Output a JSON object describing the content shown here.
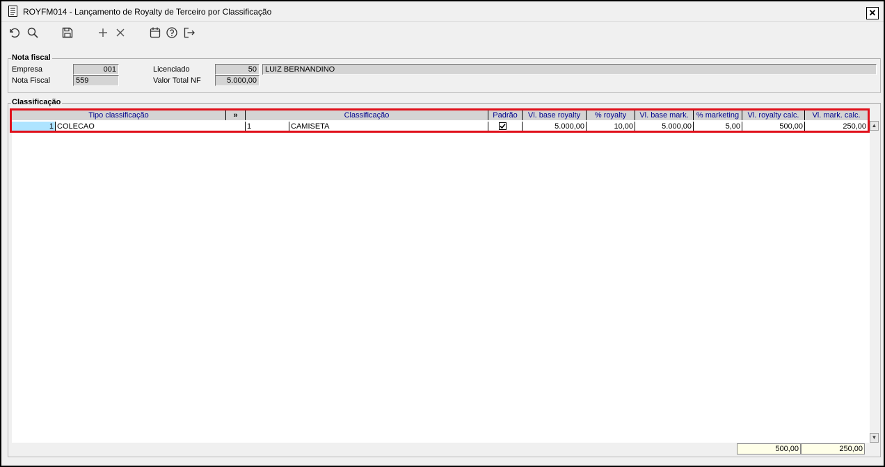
{
  "window": {
    "title": "ROYFM014 - Lançamento de Royalty de Terceiro por Classificação",
    "close_label": "✕"
  },
  "toolbar": {
    "icons": [
      "undo-icon",
      "search-icon",
      "save-icon",
      "add-icon",
      "delete-icon",
      "calendar-icon",
      "help-icon",
      "exit-icon"
    ]
  },
  "nota_fiscal": {
    "legend": "Nota fiscal",
    "empresa_label": "Empresa",
    "empresa_value": "001",
    "nota_label": "Nota Fiscal",
    "nota_value": "559",
    "licenciado_label": "Licenciado",
    "licenciado_code": "50",
    "licenciado_name": "LUIZ BERNANDINO",
    "valor_label": "Valor Total NF",
    "valor_value": "5.000,00"
  },
  "classificacao": {
    "legend": "Classificação",
    "columns": {
      "tipo": "Tipo classificação",
      "expand": "»",
      "classificacao": "Classificação",
      "padrao": "Padrão",
      "vl_base_royalty": "Vl. base royalty",
      "pct_royalty": "% royalty",
      "vl_base_mark": "Vl. base mark.",
      "pct_marketing": "% marketing",
      "vl_royalty_calc": "Vl. royalty calc.",
      "vl_mark_calc": "Vl. mark. calc."
    },
    "rows": [
      {
        "tipo_code": "1",
        "tipo_desc": "COLECAO",
        "class_code": "1",
        "class_desc": "CAMISETA",
        "padrao": true,
        "vl_base_royalty": "5.000,00",
        "pct_royalty": "10,00",
        "vl_base_mark": "5.000,00",
        "pct_marketing": "5,00",
        "vl_royalty_calc": "500,00",
        "vl_mark_calc": "250,00"
      }
    ],
    "totals": {
      "royalty": "500,00",
      "marketing": "250,00"
    }
  }
}
